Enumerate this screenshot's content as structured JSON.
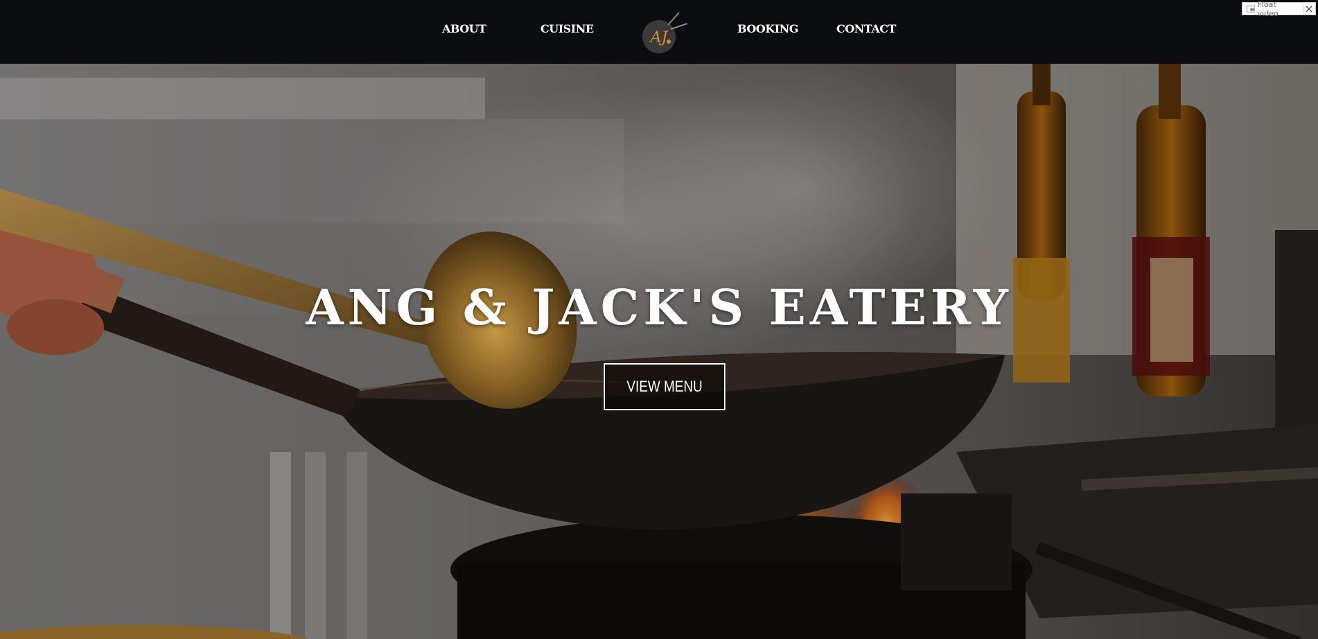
{
  "nav": {
    "about": "ABOUT",
    "cuisine": "CUISINE",
    "booking": "BOOKING",
    "contact": "CONTACT"
  },
  "logo": {
    "initials": "AJ"
  },
  "float_video": {
    "label": "Float video",
    "icon": "float-video-icon",
    "close_icon": "close-icon"
  },
  "hero": {
    "title": "ANG & JACK'S EATERY",
    "cta_label": "VIEW MENU"
  },
  "colors": {
    "topbar_bg": "#0b0d10",
    "logo_accent": "#d98a2b",
    "logo_circle": "#3a3a3a",
    "text": "#ffffff"
  }
}
